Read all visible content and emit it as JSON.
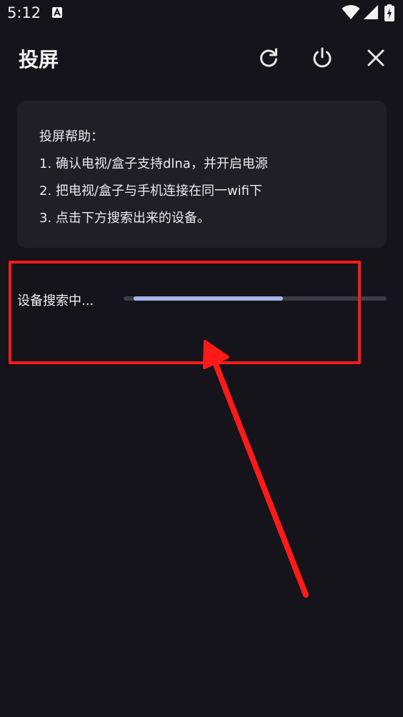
{
  "status_bar": {
    "time": "5:12",
    "icons": [
      "a-notification-icon",
      "wifi-icon",
      "signal-icon",
      "battery-charging-icon"
    ]
  },
  "header": {
    "title": "投屏",
    "icons": [
      "refresh-icon",
      "power-icon",
      "close-icon"
    ]
  },
  "help": {
    "title": "投屏帮助：",
    "lines": [
      "1. 确认电视/盒子支持dlna，并开启电源",
      "2. 把电视/盒子与手机连接在同一wifi下",
      "3. 点击下方搜索出来的设备。"
    ]
  },
  "search": {
    "label": "设备搜索中...",
    "progress": 0.59
  },
  "colors": {
    "background": "#14141a",
    "card": "#1f1f25",
    "progress_fill": "#aab2ea",
    "progress_track": "#3b3c45",
    "annotation": "#ff1a1a"
  }
}
